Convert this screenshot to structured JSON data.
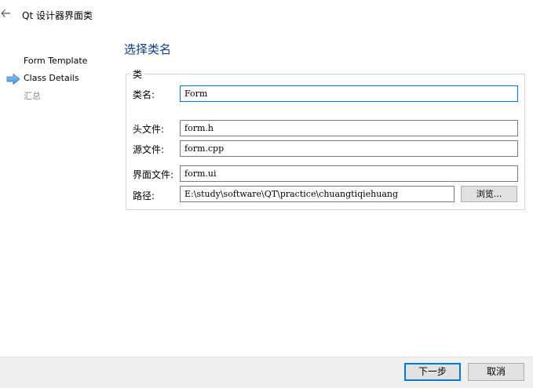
{
  "window": {
    "title": "Qt 设计器界面类"
  },
  "steps": [
    {
      "label": "Form Template"
    },
    {
      "label": "Class Details"
    },
    {
      "label": "汇总"
    }
  ],
  "page": {
    "title": "选择类名"
  },
  "group": {
    "legend": "类",
    "class_name_label": "类名:",
    "class_name_value": "Form",
    "header_label": "头文件:",
    "header_value": "form.h",
    "source_label": "源文件:",
    "source_value": "form.cpp",
    "ui_label": "界面文件:",
    "ui_value": "form.ui",
    "path_label": "路径:",
    "path_value": "E:\\study\\software\\QT\\practice\\chuangtiqiehuang",
    "browse_label": "浏览..."
  },
  "footer": {
    "next_label": "下一步",
    "cancel_label": "取消"
  }
}
